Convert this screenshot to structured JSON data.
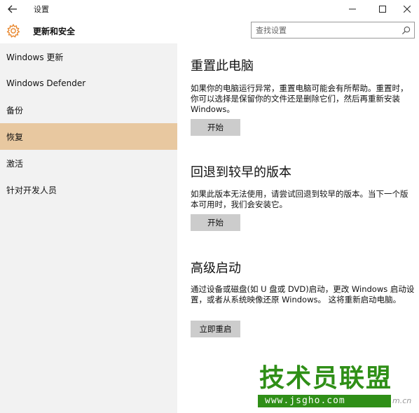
{
  "window": {
    "title": "设置",
    "back_icon": "back-arrow-icon",
    "minimize_icon": "minimize-icon",
    "maximize_icon": "maximize-icon",
    "close_icon": "close-icon"
  },
  "header": {
    "icon": "gear-icon",
    "title": "更新和安全",
    "accent_color": "#e8862c",
    "search": {
      "placeholder": "查找设置",
      "icon": "search-icon"
    }
  },
  "sidebar": {
    "active_color": "#e8c8a0",
    "items": [
      {
        "label": "Windows 更新",
        "active": false
      },
      {
        "label": "Windows Defender",
        "active": false
      },
      {
        "label": "备份",
        "active": false
      },
      {
        "label": "恢复",
        "active": true
      },
      {
        "label": "激活",
        "active": false
      },
      {
        "label": "针对开发人员",
        "active": false
      }
    ]
  },
  "main": {
    "sections": [
      {
        "title": "重置此电脑",
        "description": "如果你的电脑运行异常，重置电脑可能会有所帮助。重置时，你可以选择是保留你的文件还是删除它们，然后再重新安装 Windows。",
        "button": "开始"
      },
      {
        "title": "回退到较早的版本",
        "description": "如果此版本无法使用，请尝试回退到较早的版本。当下一个版本可用时，我们会安装它。",
        "button": "开始"
      },
      {
        "title": "高级启动",
        "description": "通过设备或磁盘(如 U 盘或 DVD)启动，更改 Windows 启动设置，或者从系统映像还原 Windows。 这将重新启动电脑。",
        "button": "立即重启"
      }
    ]
  },
  "watermark": {
    "title": "技术员联盟",
    "url": "www.jsgho.com",
    "tail": "m.cn",
    "color": "#2f8f17"
  }
}
